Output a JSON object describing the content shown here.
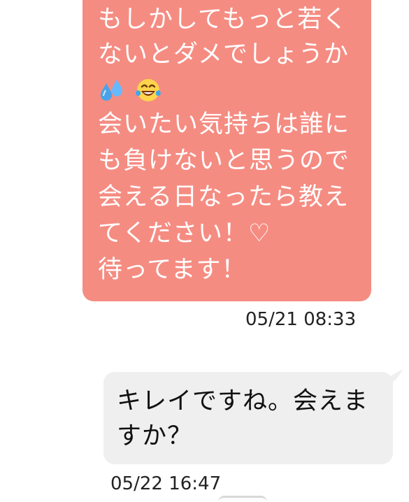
{
  "messages": {
    "incoming": {
      "line_1": "もしかしてもっと若く",
      "line_2": "ないとダメでしょうか",
      "line_4": "会いたい気持ちは誰に",
      "line_5": "も負けないと思うので",
      "line_6": "会える日なったら教え",
      "line_7": "てください！♡",
      "line_8": "待ってます！",
      "emoji_1": "sweat-droplets-emoji",
      "emoji_2": "face-with-tears-of-joy-emoji",
      "timestamp": "05/21 08:33"
    },
    "outgoing": {
      "line_1": "キレイですね。会えま",
      "line_2": "すか？",
      "timestamp": "05/22 16:47"
    }
  },
  "colors": {
    "incoming_bubble": "#f58c82",
    "outgoing_bubble": "#efefef"
  }
}
